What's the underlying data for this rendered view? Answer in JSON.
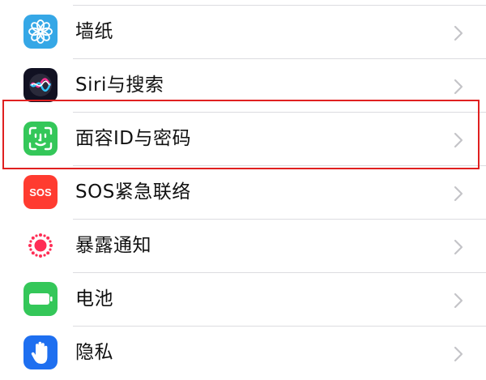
{
  "settings": {
    "items": [
      {
        "label": "墙纸",
        "icon": "wallpaper-flower-icon",
        "icon_color": "#35a7e6"
      },
      {
        "label": "Siri与搜索",
        "icon": "siri-icon",
        "icon_color": "#1c1c30"
      },
      {
        "label": "面容ID与密码",
        "icon": "face-id-icon",
        "icon_color": "#34c759"
      },
      {
        "label": "SOS紧急联络",
        "icon": "sos-icon",
        "icon_color": "#ff3b30",
        "icon_text": "SOS"
      },
      {
        "label": "暴露通知",
        "icon": "exposure-notification-icon",
        "icon_color": "#ffffff"
      },
      {
        "label": "电池",
        "icon": "battery-icon",
        "icon_color": "#34c759"
      },
      {
        "label": "隐私",
        "icon": "privacy-hand-icon",
        "icon_color": "#1e6ff0"
      }
    ],
    "highlighted_item": "面容ID与密码",
    "highlight_color": "#e02020",
    "chevron_color": "#c4c4c8"
  }
}
